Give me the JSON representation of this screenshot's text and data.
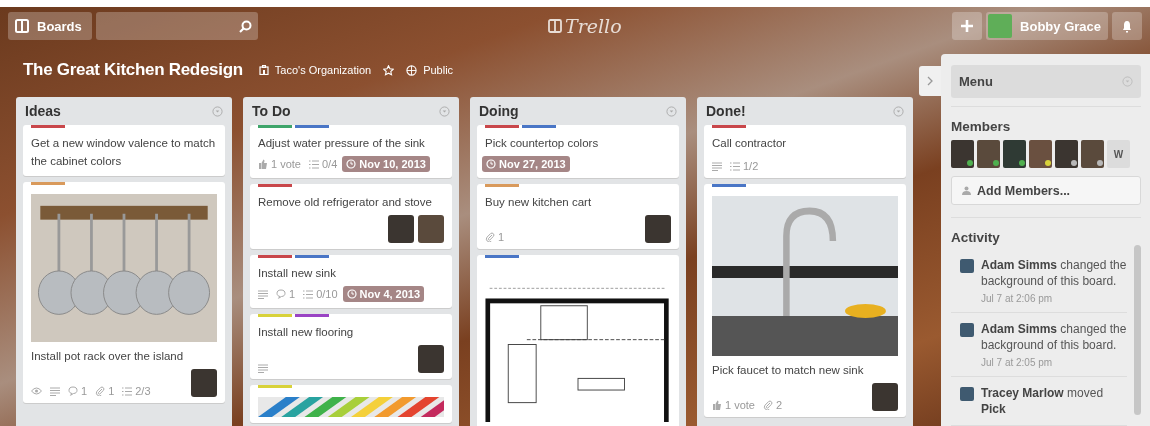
{
  "header": {
    "boards_button": "Boards",
    "logo": "Trello",
    "user_name": "Bobby Grace"
  },
  "board": {
    "title": "The Great Kitchen Redesign",
    "organization": "Taco's Organization",
    "starred": false,
    "visibility": "Public"
  },
  "lists": [
    {
      "name": "Ideas",
      "cards": [
        {
          "labels": [
            {
              "color": "#c9474b"
            }
          ],
          "title": "Get a new window valence to match the cabinet colors"
        },
        {
          "labels": [
            {
              "color": "#d99a5c"
            }
          ],
          "cover": {
            "kind": "pots"
          },
          "title": "Install pot rack over the island",
          "badges": [
            {
              "kind": "watch"
            },
            {
              "kind": "description"
            },
            {
              "kind": "comment",
              "text": "1"
            },
            {
              "kind": "attachment",
              "text": "1"
            },
            {
              "kind": "checklist",
              "text": "2/3"
            }
          ],
          "members": [
            {
              "kind": "photo"
            }
          ]
        }
      ]
    },
    {
      "name": "To Do",
      "cards": [
        {
          "labels": [
            {
              "color": "#3fa56b"
            },
            {
              "color": "#4a76c6"
            }
          ],
          "title": "Adjust water pressure of the sink",
          "badges": [
            {
              "kind": "vote",
              "text": "1 vote"
            },
            {
              "kind": "checklist",
              "text": "0/4"
            },
            {
              "kind": "due",
              "text": "Nov 10, 2013"
            }
          ]
        },
        {
          "labels": [
            {
              "color": "#c9474b"
            }
          ],
          "title": "Remove old refrigerator and stove",
          "members": [
            {
              "kind": "photo"
            },
            {
              "kind": "photo"
            }
          ]
        },
        {
          "labels": [
            {
              "color": "#c9474b"
            },
            {
              "color": "#4a76c6"
            }
          ],
          "title": "Install new sink",
          "badges": [
            {
              "kind": "description"
            },
            {
              "kind": "comment",
              "text": "1"
            },
            {
              "kind": "checklist",
              "text": "0/10"
            },
            {
              "kind": "due",
              "text": "Nov 4, 2013"
            }
          ]
        },
        {
          "labels": [
            {
              "color": "#d8d23a"
            },
            {
              "color": "#9a44c4"
            }
          ],
          "title": "Install new flooring",
          "badges": [
            {
              "kind": "description"
            }
          ],
          "members": [
            {
              "kind": "photo"
            }
          ]
        },
        {
          "labels": [
            {
              "color": "#d8d23a"
            }
          ],
          "cover": {
            "kind": "swatches"
          }
        }
      ]
    },
    {
      "name": "Doing",
      "cards": [
        {
          "labels": [
            {
              "color": "#c9474b"
            },
            {
              "color": "#4a76c6"
            }
          ],
          "title": "Pick countertop colors",
          "badges": [
            {
              "kind": "due",
              "text": "Nov 27, 2013"
            }
          ]
        },
        {
          "labels": [
            {
              "color": "#d99a5c"
            }
          ],
          "title": "Buy new kitchen cart",
          "badges": [
            {
              "kind": "attachment",
              "text": "1"
            }
          ],
          "members": [
            {
              "kind": "photo"
            }
          ]
        },
        {
          "labels": [
            {
              "color": "#4a76c6"
            }
          ],
          "cover": {
            "kind": "plan"
          }
        }
      ]
    },
    {
      "name": "Done!",
      "cards": [
        {
          "labels": [
            {
              "color": "#c9474b"
            }
          ],
          "title": "Call contractor",
          "badges": [
            {
              "kind": "description"
            },
            {
              "kind": "checklist",
              "text": "1/2"
            }
          ]
        },
        {
          "labels": [
            {
              "color": "#4a76c6"
            }
          ],
          "cover": {
            "kind": "faucet"
          },
          "title": "Pick faucet to match new sink",
          "badges": [
            {
              "kind": "vote",
              "text": "1 vote"
            },
            {
              "kind": "attachment",
              "text": "2"
            }
          ],
          "members": [
            {
              "kind": "photo"
            }
          ]
        }
      ]
    }
  ],
  "sidebar": {
    "title": "Menu",
    "members_heading": "Members",
    "members": [
      {
        "color": "#4fb04f"
      },
      {
        "color": "#4fb04f"
      },
      {
        "color": "#4fb04f"
      },
      {
        "color": "#d8d23a"
      },
      {
        "color": "#b8b8b8"
      },
      {
        "color": "#b8b8b8"
      }
    ],
    "initial_member": "W",
    "add_members": "Add Members...",
    "activity_heading": "Activity",
    "activity": [
      {
        "text": "**Adam Simms** changed the background of this board.",
        "time": "Jul 7 at 2:06 pm"
      },
      {
        "text": "**Adam Simms** changed the background of this board.",
        "time": "Jul 7 at 2:05 pm"
      },
      {
        "text": "**Tracey Marlow** moved **Pick**"
      }
    ]
  }
}
